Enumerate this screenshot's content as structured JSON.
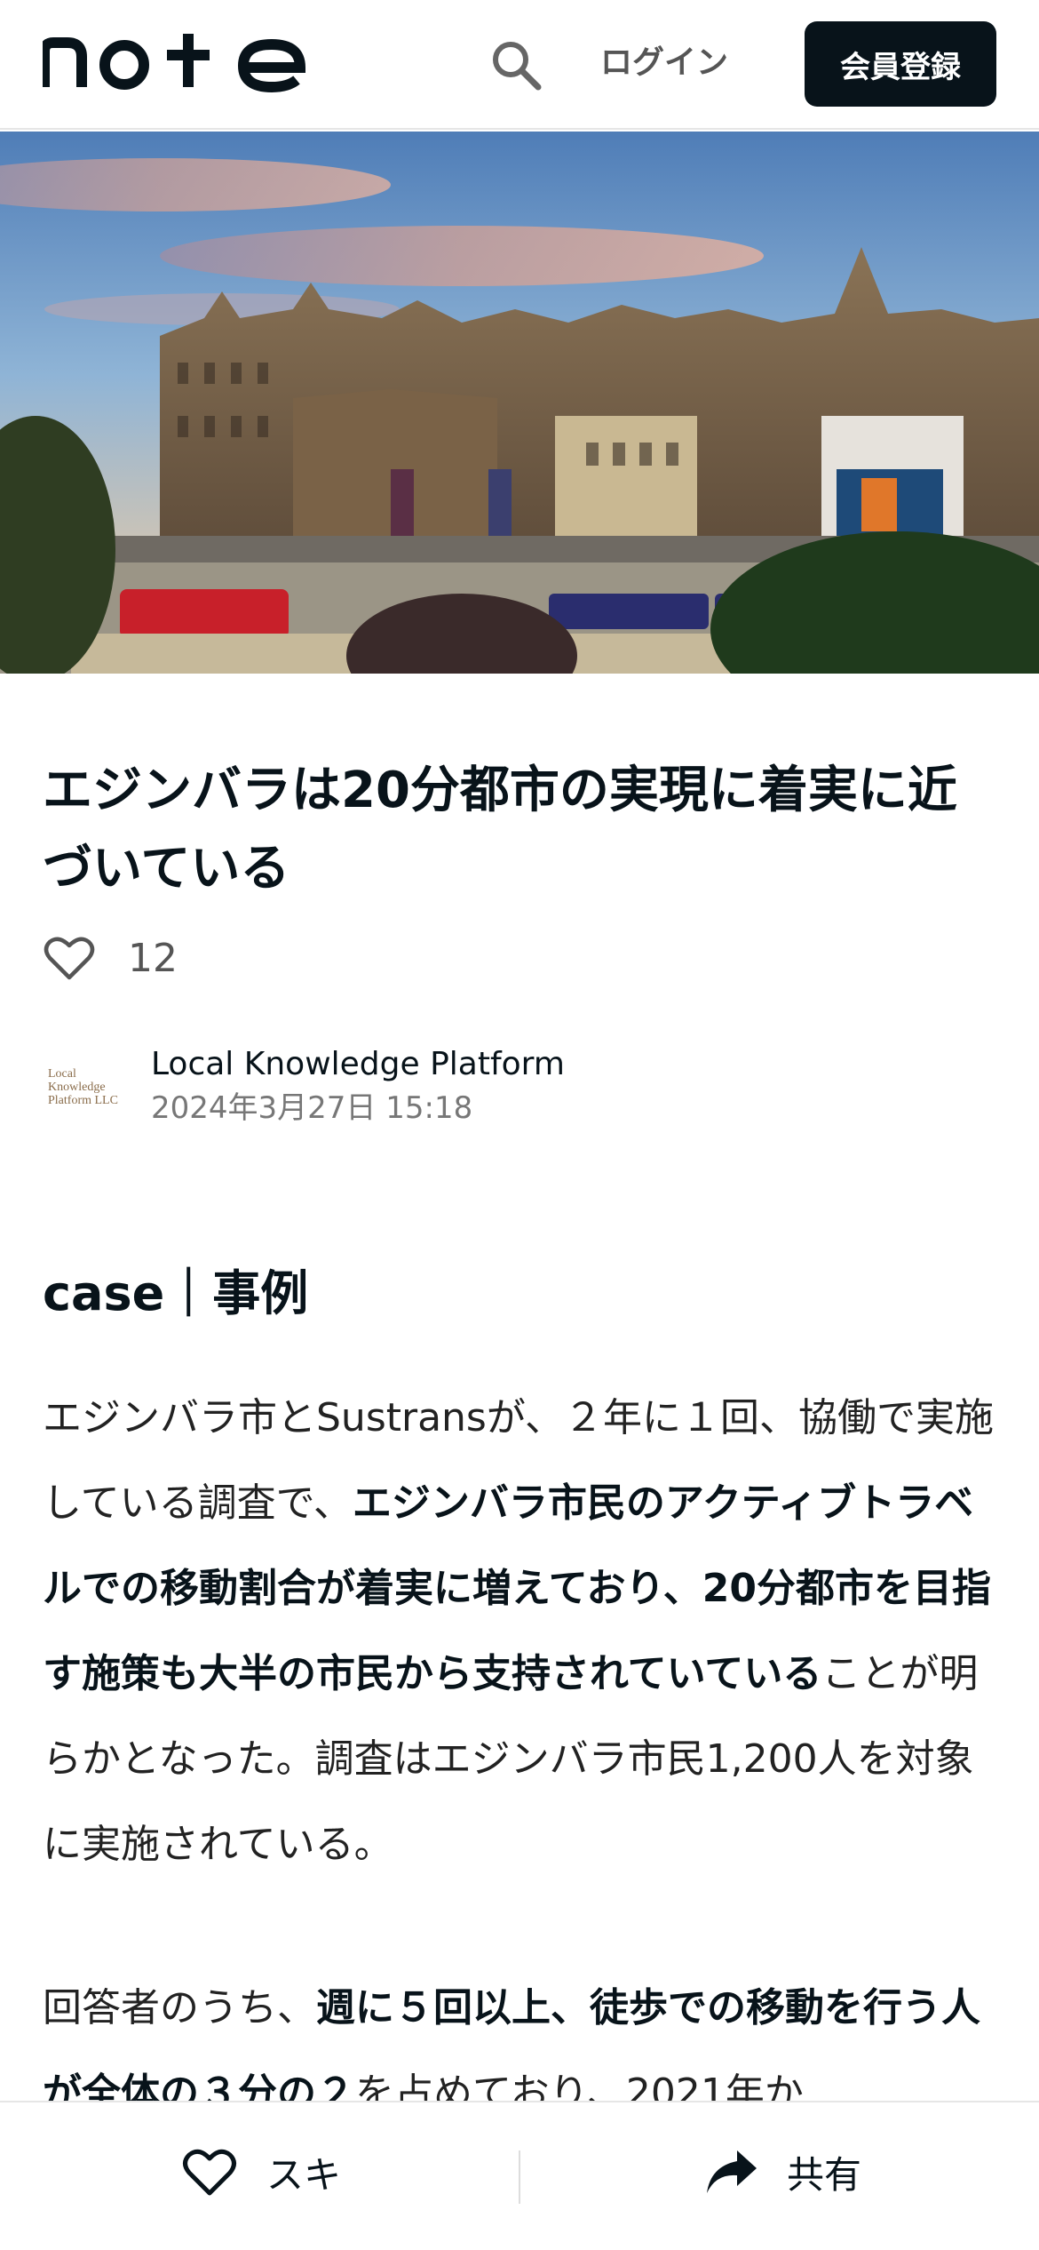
{
  "header": {
    "logo_text": "note",
    "login_label": "ログイン",
    "signup_label": "会員登録"
  },
  "article": {
    "title": "エジンバラは20分都市の実現に着実に近づいている",
    "like_count": "12",
    "author_name": "Local Knowledge Platform",
    "author_avatar_text": [
      "Local",
      "Knowledge",
      "Platform LLC"
    ],
    "date": "2024年3月27日 15:18",
    "section_heading": "case｜事例",
    "p1": {
      "t1": "エジンバラ市とSustransが、２年に１回、協働で実施している調査で、",
      "b1": "エジンバラ市民のアクティブトラベルでの移動割合が着実に増えており、20分都市を目指す施策も大半の市民から支持されていている",
      "t2": "ことが明らかとなった。調査はエジンバラ市民1,200人を対象に実施されている。"
    },
    "p2": {
      "t1": "回答者のうち、",
      "b1": "週に５回以上、徒歩での移動を行う人が全体の３分の２",
      "t2": "を占めており、2021年か"
    }
  },
  "bottom_bar": {
    "like_label": "スキ",
    "share_label": "共有"
  },
  "colors": {
    "primary": "#08131a",
    "muted": "#777777",
    "border": "#e6e6e6"
  }
}
